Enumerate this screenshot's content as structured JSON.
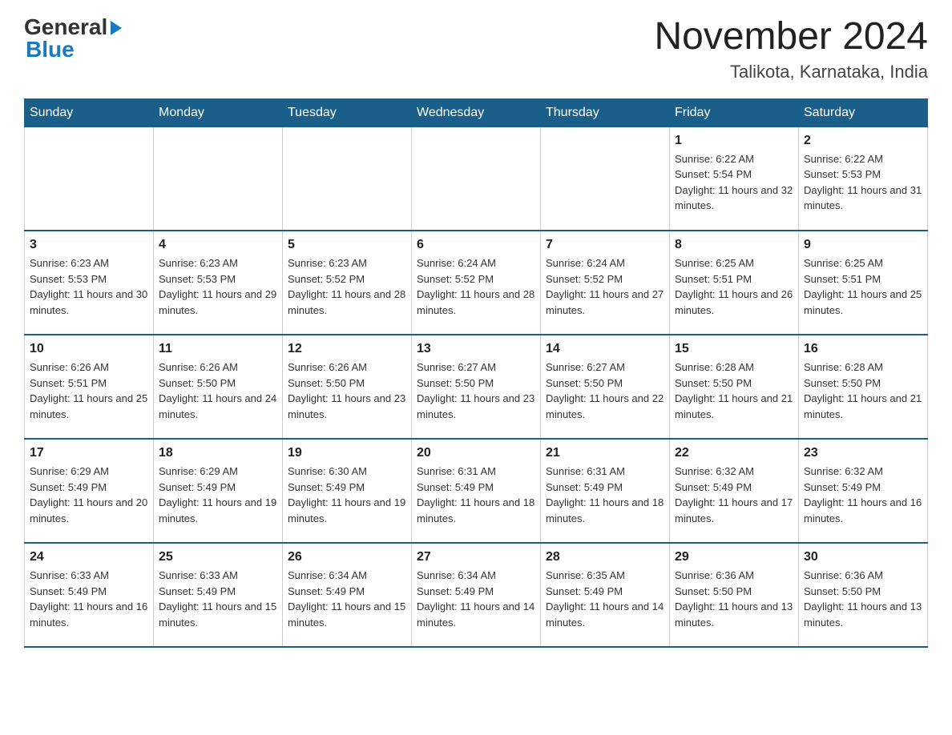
{
  "header": {
    "logo_general": "General",
    "logo_blue": "Blue",
    "month_title": "November 2024",
    "location": "Talikota, Karnataka, India"
  },
  "weekdays": [
    "Sunday",
    "Monday",
    "Tuesday",
    "Wednesday",
    "Thursday",
    "Friday",
    "Saturday"
  ],
  "weeks": [
    {
      "days": [
        {
          "number": "",
          "info": ""
        },
        {
          "number": "",
          "info": ""
        },
        {
          "number": "",
          "info": ""
        },
        {
          "number": "",
          "info": ""
        },
        {
          "number": "",
          "info": ""
        },
        {
          "number": "1",
          "info": "Sunrise: 6:22 AM\nSunset: 5:54 PM\nDaylight: 11 hours and 32 minutes."
        },
        {
          "number": "2",
          "info": "Sunrise: 6:22 AM\nSunset: 5:53 PM\nDaylight: 11 hours and 31 minutes."
        }
      ]
    },
    {
      "days": [
        {
          "number": "3",
          "info": "Sunrise: 6:23 AM\nSunset: 5:53 PM\nDaylight: 11 hours and 30 minutes."
        },
        {
          "number": "4",
          "info": "Sunrise: 6:23 AM\nSunset: 5:53 PM\nDaylight: 11 hours and 29 minutes."
        },
        {
          "number": "5",
          "info": "Sunrise: 6:23 AM\nSunset: 5:52 PM\nDaylight: 11 hours and 28 minutes."
        },
        {
          "number": "6",
          "info": "Sunrise: 6:24 AM\nSunset: 5:52 PM\nDaylight: 11 hours and 28 minutes."
        },
        {
          "number": "7",
          "info": "Sunrise: 6:24 AM\nSunset: 5:52 PM\nDaylight: 11 hours and 27 minutes."
        },
        {
          "number": "8",
          "info": "Sunrise: 6:25 AM\nSunset: 5:51 PM\nDaylight: 11 hours and 26 minutes."
        },
        {
          "number": "9",
          "info": "Sunrise: 6:25 AM\nSunset: 5:51 PM\nDaylight: 11 hours and 25 minutes."
        }
      ]
    },
    {
      "days": [
        {
          "number": "10",
          "info": "Sunrise: 6:26 AM\nSunset: 5:51 PM\nDaylight: 11 hours and 25 minutes."
        },
        {
          "number": "11",
          "info": "Sunrise: 6:26 AM\nSunset: 5:50 PM\nDaylight: 11 hours and 24 minutes."
        },
        {
          "number": "12",
          "info": "Sunrise: 6:26 AM\nSunset: 5:50 PM\nDaylight: 11 hours and 23 minutes."
        },
        {
          "number": "13",
          "info": "Sunrise: 6:27 AM\nSunset: 5:50 PM\nDaylight: 11 hours and 23 minutes."
        },
        {
          "number": "14",
          "info": "Sunrise: 6:27 AM\nSunset: 5:50 PM\nDaylight: 11 hours and 22 minutes."
        },
        {
          "number": "15",
          "info": "Sunrise: 6:28 AM\nSunset: 5:50 PM\nDaylight: 11 hours and 21 minutes."
        },
        {
          "number": "16",
          "info": "Sunrise: 6:28 AM\nSunset: 5:50 PM\nDaylight: 11 hours and 21 minutes."
        }
      ]
    },
    {
      "days": [
        {
          "number": "17",
          "info": "Sunrise: 6:29 AM\nSunset: 5:49 PM\nDaylight: 11 hours and 20 minutes."
        },
        {
          "number": "18",
          "info": "Sunrise: 6:29 AM\nSunset: 5:49 PM\nDaylight: 11 hours and 19 minutes."
        },
        {
          "number": "19",
          "info": "Sunrise: 6:30 AM\nSunset: 5:49 PM\nDaylight: 11 hours and 19 minutes."
        },
        {
          "number": "20",
          "info": "Sunrise: 6:31 AM\nSunset: 5:49 PM\nDaylight: 11 hours and 18 minutes."
        },
        {
          "number": "21",
          "info": "Sunrise: 6:31 AM\nSunset: 5:49 PM\nDaylight: 11 hours and 18 minutes."
        },
        {
          "number": "22",
          "info": "Sunrise: 6:32 AM\nSunset: 5:49 PM\nDaylight: 11 hours and 17 minutes."
        },
        {
          "number": "23",
          "info": "Sunrise: 6:32 AM\nSunset: 5:49 PM\nDaylight: 11 hours and 16 minutes."
        }
      ]
    },
    {
      "days": [
        {
          "number": "24",
          "info": "Sunrise: 6:33 AM\nSunset: 5:49 PM\nDaylight: 11 hours and 16 minutes."
        },
        {
          "number": "25",
          "info": "Sunrise: 6:33 AM\nSunset: 5:49 PM\nDaylight: 11 hours and 15 minutes."
        },
        {
          "number": "26",
          "info": "Sunrise: 6:34 AM\nSunset: 5:49 PM\nDaylight: 11 hours and 15 minutes."
        },
        {
          "number": "27",
          "info": "Sunrise: 6:34 AM\nSunset: 5:49 PM\nDaylight: 11 hours and 14 minutes."
        },
        {
          "number": "28",
          "info": "Sunrise: 6:35 AM\nSunset: 5:49 PM\nDaylight: 11 hours and 14 minutes."
        },
        {
          "number": "29",
          "info": "Sunrise: 6:36 AM\nSunset: 5:50 PM\nDaylight: 11 hours and 13 minutes."
        },
        {
          "number": "30",
          "info": "Sunrise: 6:36 AM\nSunset: 5:50 PM\nDaylight: 11 hours and 13 minutes."
        }
      ]
    }
  ]
}
